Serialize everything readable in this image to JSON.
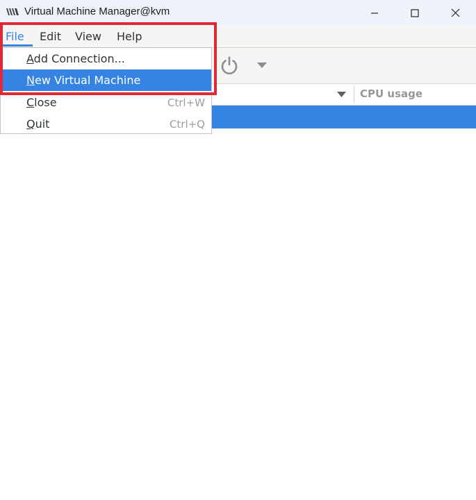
{
  "window": {
    "title": "Virtual Machine Manager@kvm",
    "icons": {
      "app": "vmm-logo-icon",
      "minimize": "minimize-icon",
      "maximize": "maximize-icon",
      "close": "close-icon"
    }
  },
  "menubar": {
    "items": [
      {
        "label": "File",
        "active": true
      },
      {
        "label": "Edit"
      },
      {
        "label": "View"
      },
      {
        "label": "Help"
      }
    ]
  },
  "toolbar": {
    "icons": [
      "power-icon",
      "chevron-down-icon"
    ]
  },
  "table": {
    "columns": [
      {
        "label": "CPU usage"
      }
    ],
    "selected_row_index": 0
  },
  "file_menu": {
    "items": [
      {
        "mnemonic": "A",
        "rest": "dd Connection...",
        "accelerator": ""
      },
      {
        "mnemonic": "N",
        "rest": "ew Virtual Machine",
        "accelerator": "",
        "highlighted": true
      },
      {
        "mnemonic": "C",
        "rest": "lose",
        "accelerator": "Ctrl+W"
      },
      {
        "mnemonic": "Q",
        "rest": "uit",
        "accelerator": "Ctrl+Q"
      }
    ]
  },
  "colors": {
    "accent": "#3584e4",
    "annotation": "#e02837",
    "titlebar": "#eef3fa"
  }
}
